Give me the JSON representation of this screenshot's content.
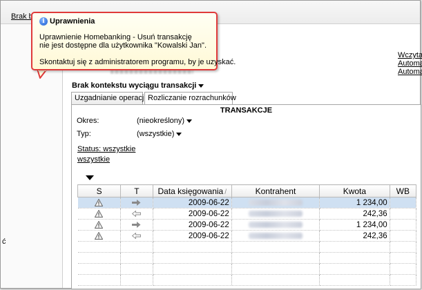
{
  "topbar": {
    "link_label": "Brak bl"
  },
  "left_panel": {
    "mark": "ć"
  },
  "right_links": [
    "Wczyta",
    "Automa",
    "Automa"
  ],
  "tooltip": {
    "title": "Uprawnienia",
    "line1": "Uprawnienie Homebanking - Usuń transakcję",
    "line2": "nie jest dostępne dla użytkownika \"Kowalski Jan\".",
    "line3": "Skontaktuj się z administratorem programu, by je uzyskać."
  },
  "context": {
    "title": "Brak kontekstu wyciągu transakcji"
  },
  "tabs": [
    {
      "label": "Uzgadnianie operacji"
    },
    {
      "label": "Rozliczanie rozrachunków"
    }
  ],
  "section": {
    "title": "TRANSAKCJE"
  },
  "filters": {
    "okres_label": "Okres:",
    "okres_value": "(nieokreślony)",
    "typ_label": "Typ:",
    "typ_value": "(wszystkie)",
    "status_line1": "Status: wszystkie",
    "status_line2": "wszystkie"
  },
  "table": {
    "columns": [
      "S",
      "T",
      "Data księgowania",
      "Kontrahent",
      "Kwota",
      "WB"
    ],
    "rows": [
      {
        "status_icon": "warning-icon",
        "type_icon": "arrow-right-icon",
        "date": "2009-06-22",
        "kontrahent": "",
        "amount": "1 234,00",
        "selected": true
      },
      {
        "status_icon": "warning-icon",
        "type_icon": "arrow-left-icon",
        "date": "2009-06-22",
        "kontrahent": "",
        "amount": "242,36",
        "selected": false
      },
      {
        "status_icon": "warning-icon",
        "type_icon": "arrow-right-icon",
        "date": "2009-06-22",
        "kontrahent": "",
        "amount": "1 234,00",
        "selected": false
      },
      {
        "status_icon": "warning-icon",
        "type_icon": "arrow-left-icon",
        "date": "2009-06-22",
        "kontrahent": "",
        "amount": "242,36",
        "selected": false
      }
    ],
    "empty_rows": 4
  },
  "colors": {
    "tooltip_border": "#e03a3a",
    "selected_row": "#cfe0f2",
    "info_icon": "#1d5fd0"
  }
}
